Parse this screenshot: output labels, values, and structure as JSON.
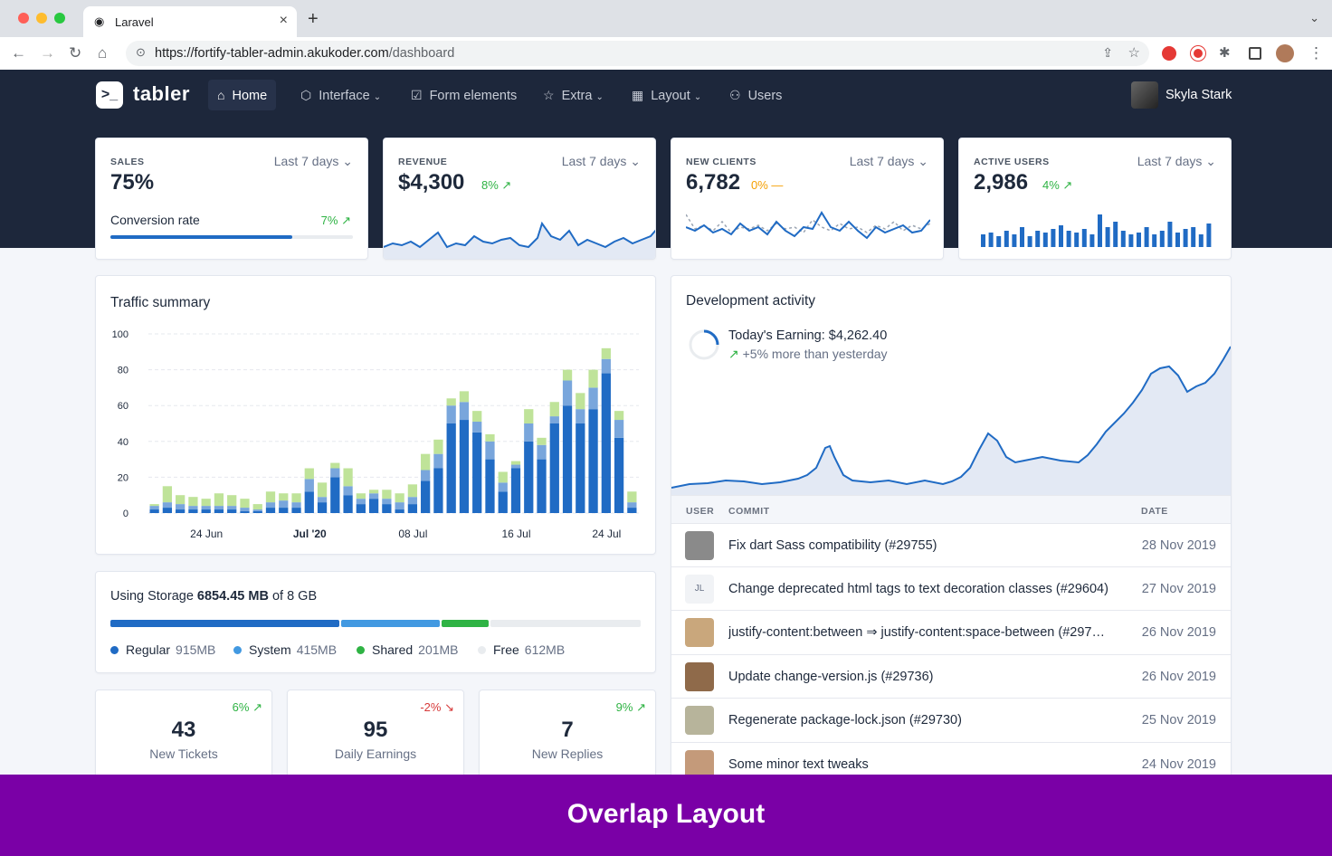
{
  "browser": {
    "tab_title": "Laravel",
    "url_host": "https://fortify-tabler-admin.akukoder.com",
    "url_path": "/dashboard"
  },
  "header": {
    "brand": "tabler",
    "nav": [
      {
        "label": "Home",
        "icon": "home-icon"
      },
      {
        "label": "Interface",
        "icon": "package-icon"
      },
      {
        "label": "Form elements",
        "icon": "checkbox-icon"
      },
      {
        "label": "Extra",
        "icon": "star-icon"
      },
      {
        "label": "Layout",
        "icon": "layout-icon"
      },
      {
        "label": "Users",
        "icon": "users-icon"
      }
    ],
    "user": "Skyla Stark"
  },
  "stats": {
    "sales": {
      "label": "SALES",
      "value": "75%",
      "range": "Last 7 days",
      "sub": "Conversion rate",
      "delta": "7%",
      "progress": 0.75
    },
    "revenue": {
      "label": "REVENUE",
      "value": "$4,300",
      "range": "Last 7 days",
      "delta": "8%"
    },
    "clients": {
      "label": "NEW CLIENTS",
      "value": "6,782",
      "range": "Last 7 days",
      "delta": "0%"
    },
    "users": {
      "label": "ACTIVE USERS",
      "value": "2,986",
      "range": "Last 7 days",
      "delta": "4%"
    }
  },
  "traffic": {
    "title": "Traffic summary"
  },
  "chart_data": {
    "type": "bar",
    "stacked": true,
    "ylim": [
      0,
      100
    ],
    "yticks": [
      0,
      20,
      40,
      60,
      80,
      100
    ],
    "xticks": [
      "24 Jun",
      "Jul '20",
      "08 Jul",
      "16 Jul",
      "24 Jul"
    ],
    "series": [
      {
        "color": "#206bc4",
        "values": [
          2,
          3,
          2,
          2,
          2,
          2,
          2,
          1,
          1,
          3,
          3,
          3,
          12,
          6,
          20,
          10,
          5,
          8,
          5,
          2,
          5,
          18,
          25,
          50,
          52,
          45,
          30,
          12,
          25,
          40,
          30,
          50,
          60,
          50,
          58,
          78,
          42,
          3
        ]
      },
      {
        "color": "#79a6dc",
        "values": [
          2,
          3,
          3,
          2,
          2,
          2,
          2,
          2,
          1,
          3,
          4,
          3,
          7,
          3,
          5,
          5,
          3,
          3,
          3,
          4,
          4,
          6,
          8,
          10,
          10,
          6,
          10,
          5,
          2,
          10,
          8,
          4,
          14,
          8,
          12,
          8,
          10,
          3
        ]
      },
      {
        "color": "#bfe399",
        "values": [
          1,
          9,
          5,
          5,
          4,
          7,
          6,
          5,
          3,
          6,
          4,
          5,
          6,
          8,
          3,
          10,
          3,
          2,
          5,
          5,
          7,
          9,
          8,
          4,
          6,
          6,
          4,
          6,
          2,
          8,
          4,
          8,
          6,
          9,
          10,
          6,
          5,
          6
        ]
      }
    ]
  },
  "storage": {
    "prefix": "Using Storage ",
    "used": "6854.45 MB",
    "suffix": " of 8 GB",
    "legend": [
      {
        "name": "Regular",
        "value": "915MB",
        "color": "#206bc4",
        "fraction": 0.436
      },
      {
        "name": "System",
        "value": "415MB",
        "color": "#4299e1",
        "fraction": 0.189
      },
      {
        "name": "Shared",
        "value": "201MB",
        "color": "#2fb344",
        "fraction": 0.088
      },
      {
        "name": "Free",
        "value": "612MB",
        "color": "#e9ecef",
        "fraction": 0.287
      }
    ]
  },
  "counters": [
    {
      "value": "43",
      "label": "New Tickets",
      "delta": "6%",
      "trend": "up"
    },
    {
      "value": "95",
      "label": "Daily Earnings",
      "delta": "-2%",
      "trend": "down"
    },
    {
      "value": "7",
      "label": "New Replies",
      "delta": "9%",
      "trend": "up"
    }
  ],
  "dev": {
    "title": "Development activity",
    "earning": "Today's Earning: $4,262.40",
    "earning_sub": "+5% more than yesterday",
    "columns": {
      "user": "USER",
      "commit": "COMMIT",
      "date": "DATE"
    },
    "rows": [
      {
        "initials": "",
        "commit": "Fix dart Sass compatibility (#29755)",
        "date": "28 Nov 2019",
        "avatar": "#8a8a8a"
      },
      {
        "initials": "JL",
        "commit": "Change deprecated html tags to text decoration classes (#29604)",
        "date": "27 Nov 2019",
        "avatar": "#f1f3f6"
      },
      {
        "initials": "",
        "commit": "justify-content:between ⇒ justify-content:space-between (#297…",
        "date": "26 Nov 2019",
        "avatar": "#c9a77c"
      },
      {
        "initials": "",
        "commit": "Update change-version.js (#29736)",
        "date": "26 Nov 2019",
        "avatar": "#8f6a4a"
      },
      {
        "initials": "",
        "commit": "Regenerate package-lock.json (#29730)",
        "date": "25 Nov 2019",
        "avatar": "#b7b49b"
      },
      {
        "initials": "",
        "commit": "Some minor text tweaks",
        "date": "24 Nov 2019",
        "avatar": "#c49a7a"
      }
    ]
  },
  "banner": "Overlap Layout"
}
